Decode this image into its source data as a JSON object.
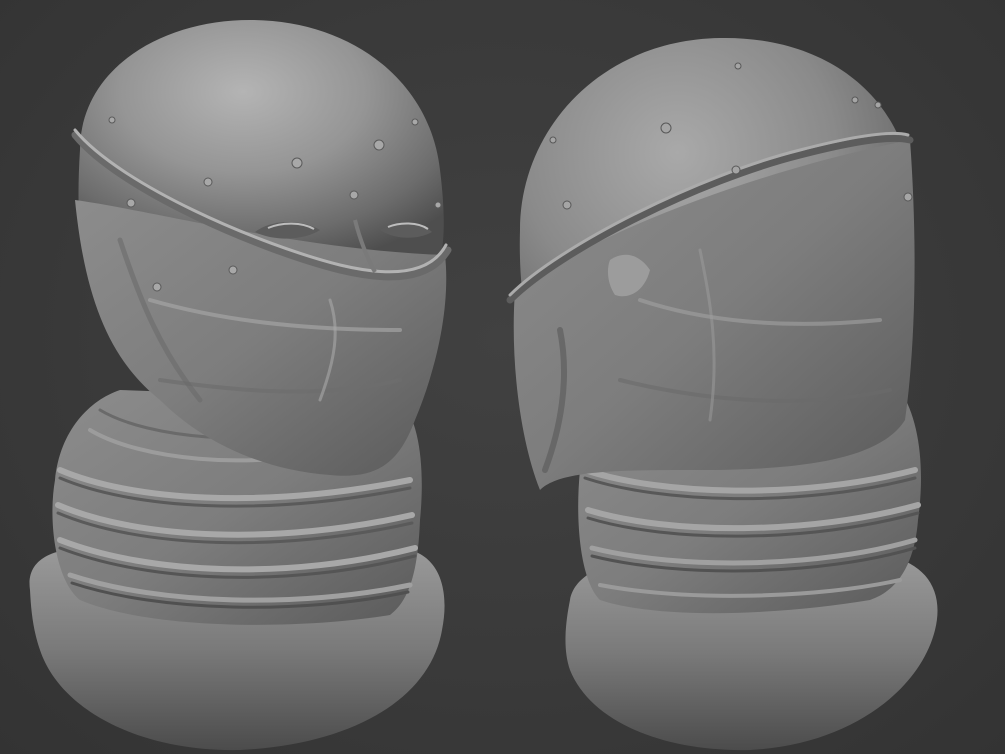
{
  "scene": {
    "background_color": "#3a3a3a",
    "material_color": "#8e8e8e",
    "objects": [
      {
        "name": "left-bust",
        "description_icon": "sculpt-head-front-three-quarter"
      },
      {
        "name": "right-bust",
        "description_icon": "sculpt-head-profile"
      }
    ]
  }
}
